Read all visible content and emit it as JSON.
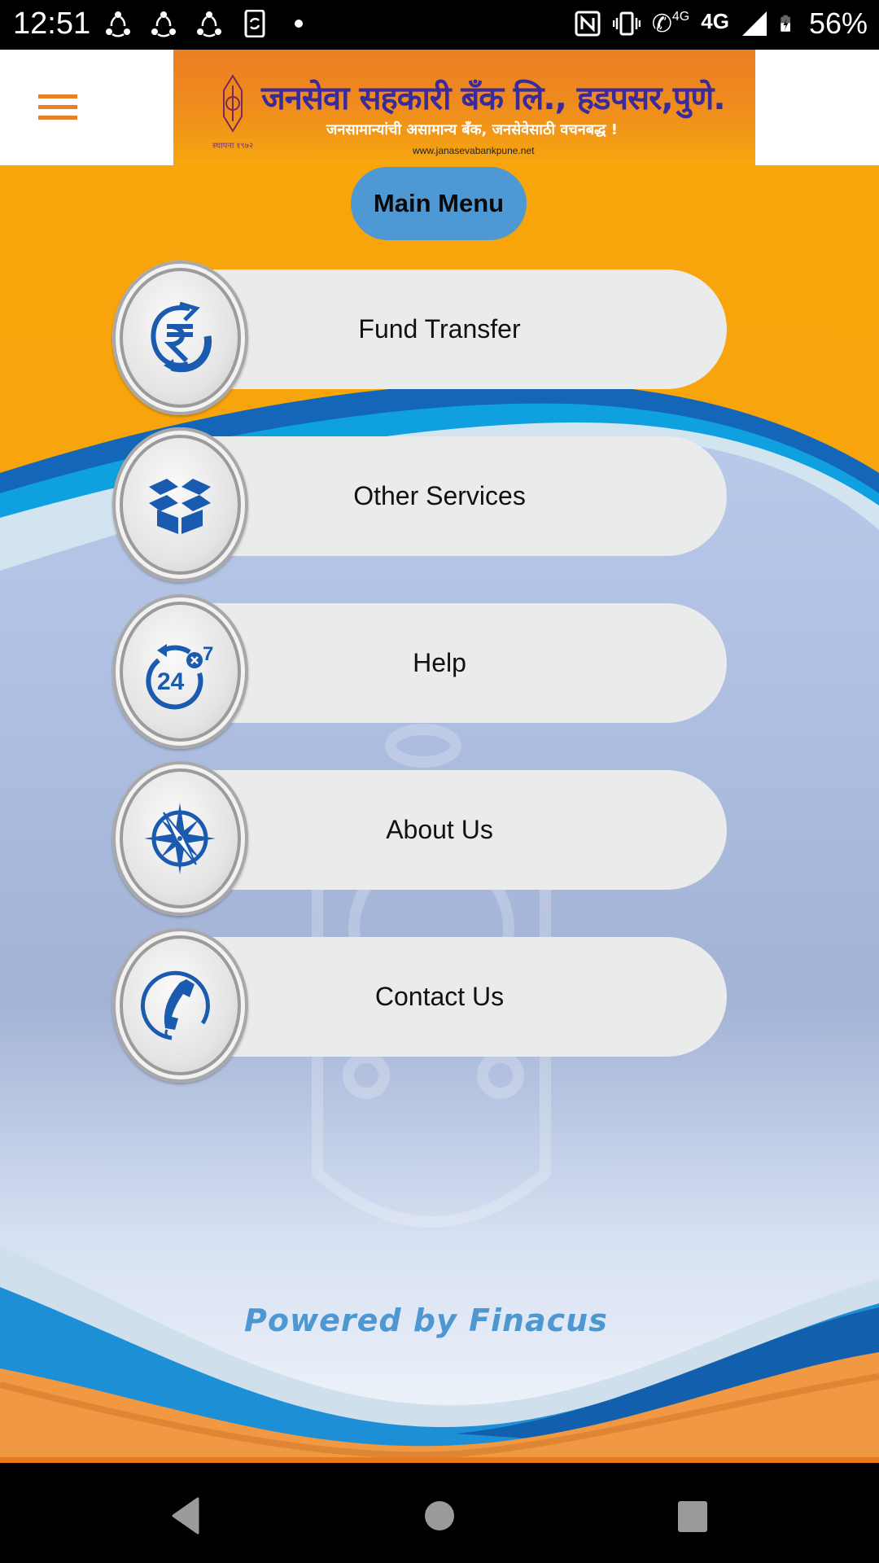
{
  "status_bar": {
    "time": "12:51",
    "left_icons": [
      "shareit-icon",
      "shareit-icon",
      "shareit-icon",
      "phone-sync-icon",
      "notification-dot-icon"
    ],
    "right_icons": [
      "nfc-icon",
      "vibrate-icon",
      "volte-call-icon",
      "network-4g-icon",
      "signal-icon",
      "battery-charging-icon"
    ],
    "network_label": "4G",
    "volte_label": "4G",
    "battery": "56%"
  },
  "header": {
    "menu_icon": "hamburger-icon",
    "bank_name": "जनसेवा सहकारी बँक लि., हडपसर,पुणे.",
    "tagline": "जनसामान्यांची असामान्य बँक, जनसेवेसाठी वचनबद्ध !",
    "website": "www.janasevabankpune.net",
    "established": "स्थापना १९७२"
  },
  "main_menu": {
    "title": "Main Menu",
    "items": [
      {
        "label": "Fund Transfer",
        "icon": "rupee-transfer-icon"
      },
      {
        "label": "Other Services",
        "icon": "open-box-icon"
      },
      {
        "label": "Help",
        "icon": "support-24x7-icon"
      },
      {
        "label": "About Us",
        "icon": "compass-icon"
      },
      {
        "label": "Contact Us",
        "icon": "phone-icon"
      }
    ]
  },
  "footer": {
    "powered_by": "Powered by Finacus"
  },
  "nav_bar": {
    "buttons": [
      "back",
      "home",
      "recents"
    ]
  },
  "colors": {
    "accent_orange": "#e8802a",
    "main_menu_blue": "#4e98d4",
    "icon_blue": "#1a5bb0",
    "pill_gray": "#eaebeb"
  }
}
